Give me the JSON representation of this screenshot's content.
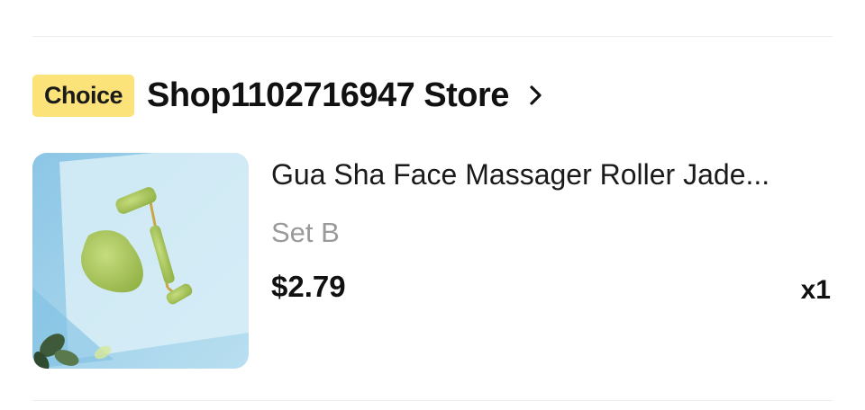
{
  "store": {
    "badge": "Choice",
    "name": "Shop1102716947 Store",
    "chevron_icon": "chevron-right-icon"
  },
  "item": {
    "title": "Gua Sha Face Massager Roller Jade...",
    "variant": "Set B",
    "price": "$2.79",
    "quantity": "x1",
    "image_icon": "product-thumbnail"
  },
  "colors": {
    "badge_bg": "#fbe37a",
    "variant_text": "#9a9a9a"
  }
}
